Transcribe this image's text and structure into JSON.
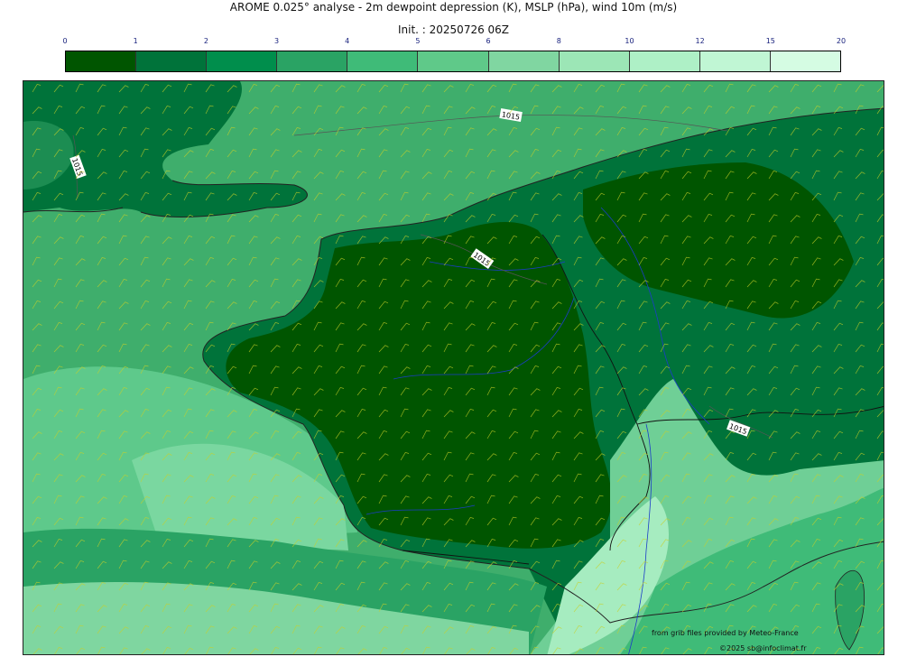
{
  "header": {
    "title": "AROME 0.025° analyse - 2m dewpoint depression (K), MSLP (hPa), wind 10m (m/s)",
    "subtitle": "Init. : 20250726 06Z"
  },
  "legend": {
    "ticks": [
      "0",
      "1",
      "2",
      "3",
      "4",
      "5",
      "6",
      "8",
      "10",
      "12",
      "15",
      "20"
    ],
    "colors": [
      "#005500",
      "#00733a",
      "#008e4c",
      "#2aa364",
      "#3fbb78",
      "#5fc989",
      "#80d6a1",
      "#9ce6b6",
      "#aef0c6",
      "#c0f6d4",
      "#d5fce3"
    ]
  },
  "map": {
    "isobar_labels": [
      "1015",
      "1015",
      "1015",
      "1015"
    ],
    "colors": {
      "sea": "#4fbf7f",
      "land_dark": "#005500",
      "land_mid": "#00733a",
      "south_light": "#7fd6a0",
      "coast": "#222222",
      "river": "#1c3cc8",
      "barb": "#c8d028"
    }
  },
  "credits": {
    "source": "from grib files provided by Meteo-France",
    "copyright": "©2025 sb@infoclimat.fr"
  }
}
